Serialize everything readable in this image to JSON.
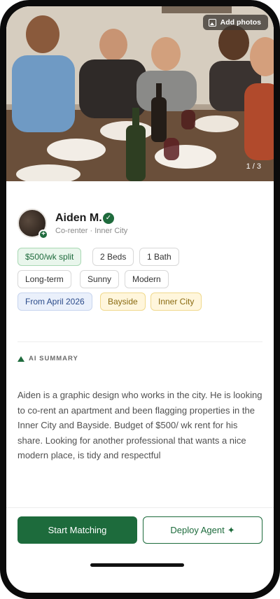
{
  "photo": {
    "add_photos_label": "Add photos",
    "counter": "1 / 3"
  },
  "profile": {
    "name": "Aiden M.",
    "subtitle": "Co-renter · Inner City"
  },
  "tags": [
    {
      "label": "$500/wk split",
      "style": "green"
    },
    {
      "label": "2 Beds",
      "style": "plain"
    },
    {
      "label": "1 Bath",
      "style": "plain"
    },
    {
      "label": "Long-term",
      "style": "plain"
    },
    {
      "label": "Sunny",
      "style": "plain"
    },
    {
      "label": "Modern",
      "style": "plain"
    },
    {
      "label": "From April 2026",
      "style": "blue"
    },
    {
      "label": "Bayside",
      "style": "yellow"
    },
    {
      "label": "Inner City",
      "style": "yellow"
    }
  ],
  "ai_summary": {
    "label": "AI SUMMARY",
    "text": "Aiden is a graphic design who works in the city. He is looking to co-rent an apartment and been flagging properties in the Inner City and Bayside. Budget of $500/ wk rent for his share. Looking for another professional that wants a nice modern place, is tidy and respectful"
  },
  "actions": {
    "start_matching": "Start Matching",
    "deploy_agent": "Deploy Agent"
  },
  "colors": {
    "brand_green": "#1d6b3c"
  }
}
